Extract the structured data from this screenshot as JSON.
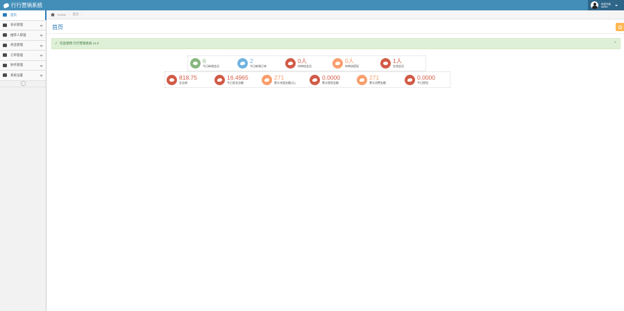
{
  "app": {
    "brand": "行行营销系统"
  },
  "user": {
    "line1": "欢迎光临",
    "line2": "admin"
  },
  "sidebar": {
    "items": [
      {
        "label": "首页",
        "icon": "dashboard-icon",
        "active": true
      },
      {
        "label": "会员管理",
        "icon": "users-icon"
      },
      {
        "label": "推荐人管理",
        "icon": "star-icon"
      },
      {
        "label": "商品管理",
        "icon": "calendar-icon"
      },
      {
        "label": "订单管理",
        "icon": "list-icon"
      },
      {
        "label": "财务管理",
        "icon": "money-icon"
      },
      {
        "label": "系统设置",
        "icon": "settings-icon"
      }
    ]
  },
  "breadcrumb": {
    "home": "Home",
    "current": "首页"
  },
  "page": {
    "title": "首页"
  },
  "alert": {
    "text": "欢迎使用 行行营销系统 v1.0"
  },
  "stats": [
    {
      "value": "6",
      "label": "今日新增会员",
      "color": "#87b87f",
      "icon": "comment-icon"
    },
    {
      "value": "2",
      "label": "今日新增订单",
      "color": "#6fb3e0",
      "icon": "twitter-icon"
    },
    {
      "value": "0人",
      "label": "待审核会员",
      "color": "#d15b47",
      "icon": "twitter-icon"
    },
    {
      "value": "0人",
      "label": "待审核提现",
      "color": "#f89e6c",
      "icon": "twitter-icon"
    },
    {
      "value": "1人",
      "label": "在线会员",
      "color": "#d15b47",
      "icon": "comment-icon"
    },
    {
      "value": "818.75",
      "label": "总业绩",
      "color": "#d15b47",
      "icon": "comment-icon"
    },
    {
      "value": "16.4965",
      "label": "今日奖金总额",
      "color": "#d15b47",
      "icon": "twitter-icon"
    },
    {
      "value": "271",
      "label": "累计充值金额(元)",
      "color": "#f89e6c",
      "icon": "twitter-icon"
    },
    {
      "value": "0.0000",
      "label": "累计提现金额",
      "color": "#d15b47",
      "icon": "twitter-icon"
    },
    {
      "value": "271",
      "label": "累计消费金额",
      "color": "#f89e6c",
      "icon": "twitter-icon"
    },
    {
      "value": "0.0000",
      "label": "今日提现",
      "color": "#d15b47",
      "icon": "twitter-icon"
    }
  ]
}
